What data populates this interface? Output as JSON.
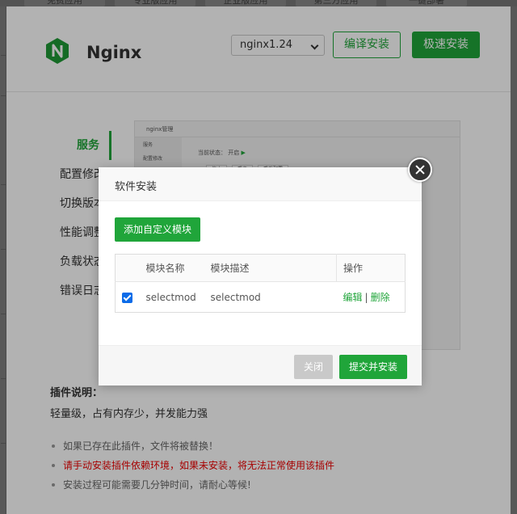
{
  "plugin": {
    "title": "Nginx",
    "version_selected": "nginx1.24",
    "compile_install_label": "编译安装",
    "fast_install_label": "极速安装",
    "brand_color": "#20a53a"
  },
  "side_nav": [
    {
      "label": "服务",
      "active": true
    },
    {
      "label": "配置修改"
    },
    {
      "label": "切换版本"
    },
    {
      "label": "性能调整"
    },
    {
      "label": "负载状态"
    },
    {
      "label": "错误日志"
    }
  ],
  "preview": {
    "window_title": "nginx管理",
    "menu": [
      "服务",
      "配置修改"
    ],
    "status_label": "当前状态：",
    "status_value": "开启",
    "buttons": [
      "停止",
      "重启",
      "重载配置"
    ]
  },
  "description": {
    "title": "插件说明：",
    "text": "轻量级，占有内存少，并发能力强",
    "tips": [
      "如果已存在此插件，文件将被替换！",
      "请手动安装插件依赖环境，如果未安装，将无法正常使用该插件",
      "安装过程可能需要几分钟时间，请耐心等候!"
    ]
  },
  "modal": {
    "title": "软件安装",
    "add_module_label": "添加自定义模块",
    "table": {
      "headers": [
        "模块名称",
        "模块描述",
        "操作"
      ],
      "rows": [
        {
          "checked": true,
          "name": "selectmod",
          "desc": "selectmod",
          "edit": "编辑",
          "sep": "|",
          "delete": "删除"
        }
      ]
    },
    "close_label": "关闭",
    "submit_label": "提交并安装"
  },
  "background": {
    "top_tabs": [
      "免费应用",
      "专业版应用",
      "企业版应用",
      "第三方应用",
      "一键部署"
    ]
  }
}
